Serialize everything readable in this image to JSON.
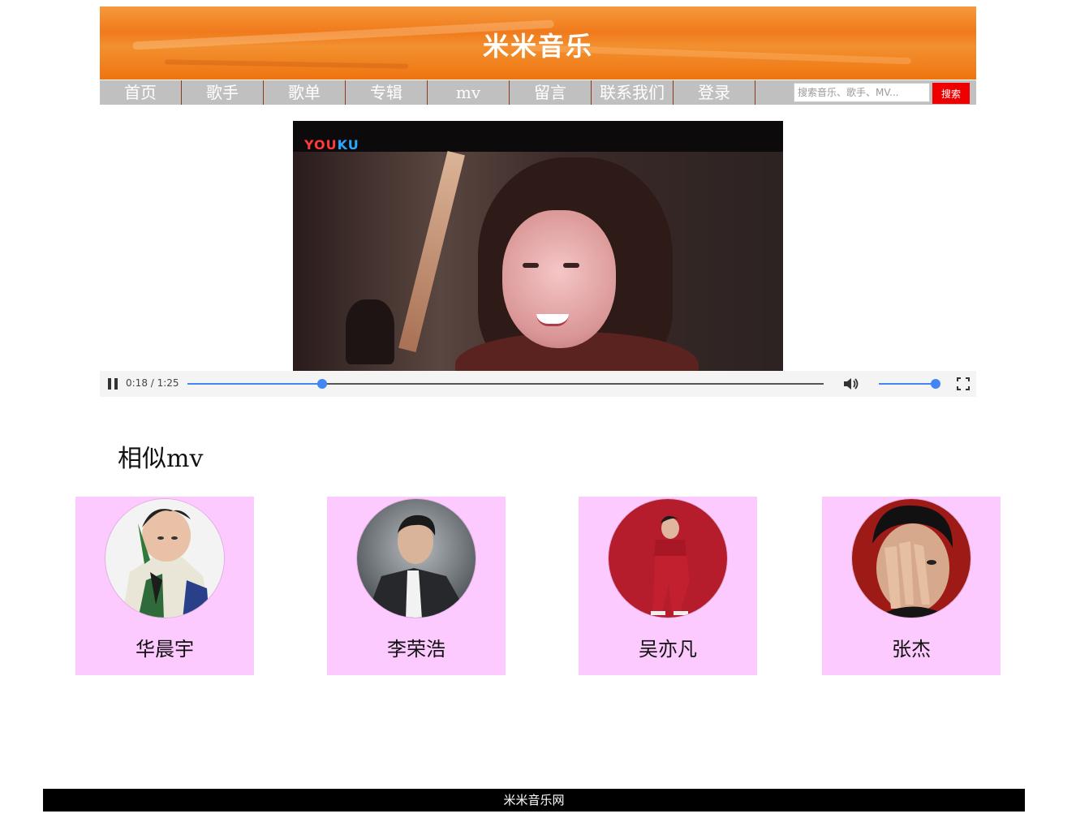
{
  "header": {
    "site_title": "米米音乐"
  },
  "nav": {
    "items": [
      "首页",
      "歌手",
      "歌单",
      "专辑",
      "mv",
      "留言",
      "联系我们",
      "登录"
    ],
    "search_placeholder": "搜索音乐、歌手、MV...",
    "search_button": "搜索"
  },
  "player": {
    "watermark_a": "YOU",
    "watermark_b": "KU",
    "time": "0:18 / 1:25",
    "progress": 0.212,
    "volume": 1.0,
    "state": "playing"
  },
  "similar": {
    "title": "相似mv",
    "cards": [
      {
        "name": "华晨宇"
      },
      {
        "name": "李荣浩"
      },
      {
        "name": "吴亦凡"
      },
      {
        "name": "张杰"
      }
    ]
  },
  "footer": {
    "text": "米米音乐网"
  },
  "colors": {
    "banner": "#f07a1c",
    "nav_bg": "#c0c0c0",
    "search_button": "#ee0000",
    "card_bg": "#fdcaff",
    "accent": "#4285f4",
    "footer_bg": "#000000"
  }
}
